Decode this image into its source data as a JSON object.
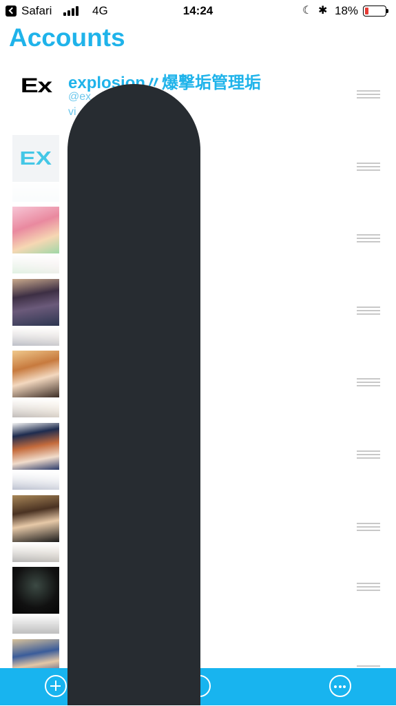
{
  "status_bar": {
    "back_app": "Safari",
    "network": "4G",
    "time": "14:24",
    "battery": "18%",
    "battery_level": 0.18,
    "moon_icon": "moon-icon",
    "bluetooth_icon": "bluetooth-icon"
  },
  "page": {
    "title": "Accounts"
  },
  "accounts": [
    {
      "name": "explosion〃爆撃垢管理垢",
      "handle": "@ex",
      "via": "vi",
      "avatar": "Ex"
    },
    {
      "avatar": "EX"
    },
    {
      "avatar": "anime-girl-pink"
    },
    {
      "avatar": "anime-girl-dark-hair"
    },
    {
      "avatar": "anime-girl-orange-hair"
    },
    {
      "avatar": "anime-girl-sailor-cap"
    },
    {
      "avatar": "anime-boy-brown-hair"
    },
    {
      "avatar": "anime-silhouette-dark"
    },
    {
      "avatar": "anime-duo-blue"
    }
  ],
  "toolbar": {
    "add_icon": "add-circle-icon",
    "compose_icon": "compose-circle-icon",
    "more_icon": "more-circle-icon"
  },
  "colors": {
    "accent": "#1fb3ea",
    "toolbar": "#18b4ef",
    "redaction": "#272c31"
  }
}
